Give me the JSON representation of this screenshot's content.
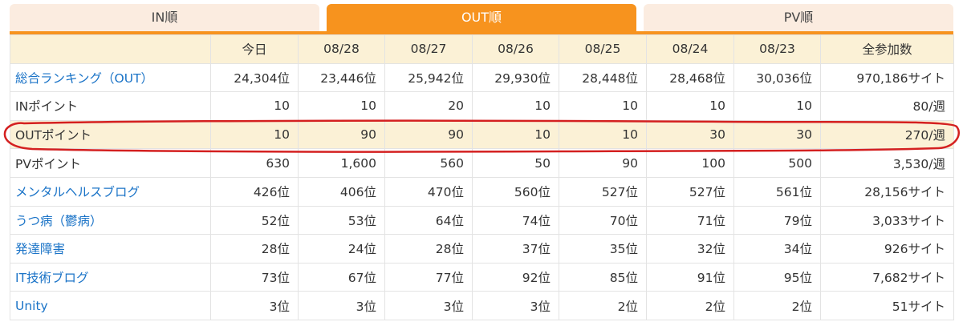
{
  "tabs": [
    {
      "label": "IN順",
      "active": false
    },
    {
      "label": "OUT順",
      "active": true
    },
    {
      "label": "PV順",
      "active": false
    }
  ],
  "table": {
    "headers": [
      "",
      "今日",
      "08/28",
      "08/27",
      "08/26",
      "08/25",
      "08/24",
      "08/23",
      "全参加数"
    ],
    "rows": [
      {
        "label": "総合ランキング（OUT）",
        "link": true,
        "cells": [
          "24,304位",
          "23,446位",
          "25,942位",
          "29,930位",
          "28,448位",
          "28,468位",
          "30,036位",
          "970,186サイト"
        ]
      },
      {
        "label": "INポイント",
        "link": false,
        "cells": [
          "10",
          "10",
          "20",
          "10",
          "10",
          "10",
          "10",
          "80/週"
        ]
      },
      {
        "label": "OUTポイント",
        "link": false,
        "highlight": true,
        "cells": [
          "10",
          "90",
          "90",
          "10",
          "10",
          "30",
          "30",
          "270/週"
        ]
      },
      {
        "label": "PVポイント",
        "link": false,
        "cells": [
          "630",
          "1,600",
          "560",
          "50",
          "90",
          "100",
          "500",
          "3,530/週"
        ]
      },
      {
        "label": "メンタルヘルスブログ",
        "link": true,
        "cells": [
          "426位",
          "406位",
          "470位",
          "560位",
          "527位",
          "527位",
          "561位",
          "28,156サイト"
        ]
      },
      {
        "label": "うつ病（鬱病）",
        "link": true,
        "cells": [
          "52位",
          "53位",
          "64位",
          "74位",
          "70位",
          "71位",
          "79位",
          "3,033サイト"
        ]
      },
      {
        "label": "発達障害",
        "link": true,
        "cells": [
          "28位",
          "24位",
          "28位",
          "37位",
          "35位",
          "32位",
          "34位",
          "926サイト"
        ]
      },
      {
        "label": "IT技術ブログ",
        "link": true,
        "cells": [
          "73位",
          "67位",
          "77位",
          "92位",
          "85位",
          "91位",
          "95位",
          "7,682サイト"
        ]
      },
      {
        "label": "Unity",
        "link": true,
        "cells": [
          "3位",
          "3位",
          "3位",
          "3位",
          "2位",
          "2位",
          "2位",
          "51サイト"
        ]
      }
    ]
  },
  "colors": {
    "accent": "#f7931e",
    "inactive_tab": "#fbece0",
    "header_bg": "#fbf1d6",
    "link": "#1a73c7",
    "annotation": "#d42020"
  }
}
